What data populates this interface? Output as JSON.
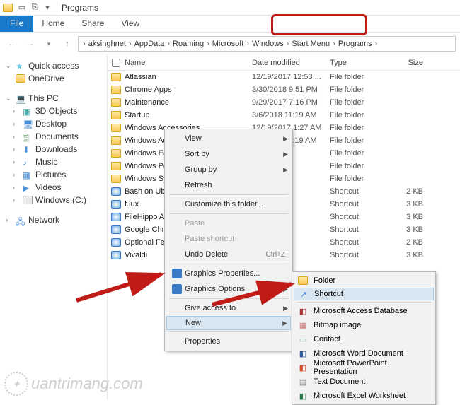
{
  "title": "Programs",
  "ribbon": {
    "file": "File",
    "home": "Home",
    "share": "Share",
    "view": "View"
  },
  "breadcrumb": [
    "aksinghnet",
    "AppData",
    "Roaming",
    "Microsoft",
    "Windows",
    "Start Menu",
    "Programs"
  ],
  "nav": {
    "quick": "Quick access",
    "onedrive": "OneDrive",
    "thispc": "This PC",
    "objects3d": "3D Objects",
    "desktop": "Desktop",
    "documents": "Documents",
    "downloads": "Downloads",
    "music": "Music",
    "pictures": "Pictures",
    "videos": "Videos",
    "windowsc": "Windows (C:)",
    "network": "Network"
  },
  "columns": {
    "name": "Name",
    "date": "Date modified",
    "type": "Type",
    "size": "Size"
  },
  "rows": [
    {
      "name": "Atlassian",
      "date": "12/19/2017 12:53 ...",
      "type": "File folder",
      "size": "",
      "ico": "folder"
    },
    {
      "name": "Chrome Apps",
      "date": "3/30/2018 9:51 PM",
      "type": "File folder",
      "size": "",
      "ico": "folder"
    },
    {
      "name": "Maintenance",
      "date": "9/29/2017 7:16 PM",
      "type": "File folder",
      "size": "",
      "ico": "folder"
    },
    {
      "name": "Startup",
      "date": "3/6/2018 11:19 AM",
      "type": "File folder",
      "size": "",
      "ico": "folder"
    },
    {
      "name": "Windows Accessories",
      "date": "12/19/2017 1:27 AM",
      "type": "File folder",
      "size": "",
      "ico": "folder"
    },
    {
      "name": "Windows Administrative Tools",
      "date": "3/6/2018 11:19 AM",
      "type": "File folder",
      "size": "",
      "ico": "folder"
    },
    {
      "name": "Windows Ease of A",
      "date": "",
      "type": "File folder",
      "size": "",
      "ico": "folder"
    },
    {
      "name": "Windows PowerSh",
      "date": "",
      "type": "File folder",
      "size": "",
      "ico": "folder"
    },
    {
      "name": "Windows System",
      "date": "",
      "type": "File folder",
      "size": "",
      "ico": "folder"
    },
    {
      "name": "Bash on Ubuntu or",
      "date": "",
      "type": "Shortcut",
      "size": "2 KB",
      "ico": "app"
    },
    {
      "name": "f.lux",
      "date": "",
      "type": "Shortcut",
      "size": "3 KB",
      "ico": "app"
    },
    {
      "name": "FileHippo App Mar",
      "date": "",
      "type": "Shortcut",
      "size": "3 KB",
      "ico": "app"
    },
    {
      "name": "Google Chrome Ca",
      "date": "",
      "type": "Shortcut",
      "size": "3 KB",
      "ico": "app"
    },
    {
      "name": "Optional Features",
      "date": "",
      "type": "Shortcut",
      "size": "2 KB",
      "ico": "app"
    },
    {
      "name": "Vivaldi",
      "date": "",
      "type": "Shortcut",
      "size": "3 KB",
      "ico": "app"
    }
  ],
  "ctx": {
    "view": "View",
    "sortby": "Sort by",
    "groupby": "Group by",
    "refresh": "Refresh",
    "customize": "Customize this folder...",
    "paste": "Paste",
    "pasteShortcut": "Paste shortcut",
    "undo": "Undo Delete",
    "undoKey": "Ctrl+Z",
    "gprops": "Graphics Properties...",
    "gopts": "Graphics Options",
    "give": "Give access to",
    "new": "New",
    "properties": "Properties"
  },
  "newMenu": {
    "folder": "Folder",
    "shortcut": "Shortcut",
    "access": "Microsoft Access Database",
    "bitmap": "Bitmap image",
    "contact": "Contact",
    "word": "Microsoft Word Document",
    "ppt": "Microsoft PowerPoint Presentation",
    "text": "Text Document",
    "excel": "Microsoft Excel Worksheet"
  },
  "watermark": "uantrimang.com"
}
